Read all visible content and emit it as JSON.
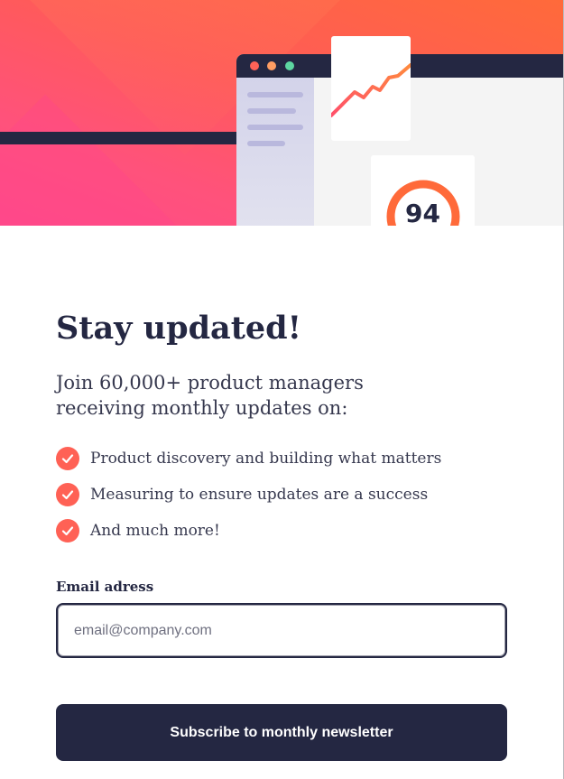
{
  "illustration": {
    "score": "94",
    "colors": {
      "coral": "#ff6155",
      "navy": "#242742",
      "gradient_start": "#ff6a3a",
      "gradient_end": "#ff527b"
    }
  },
  "content": {
    "title": "Stay updated!",
    "intro": "Join 60,000+ product managers receiving monthly updates on:",
    "features": [
      "Product discovery and building what matters",
      "Measuring to ensure updates are a success",
      "And much more!"
    ],
    "check_icon": "check-circle-icon"
  },
  "form": {
    "email_label": "Email adress",
    "email_placeholder": "email@company.com",
    "email_value": "",
    "subscribe_label": "Subscribe to monthly newsletter"
  }
}
